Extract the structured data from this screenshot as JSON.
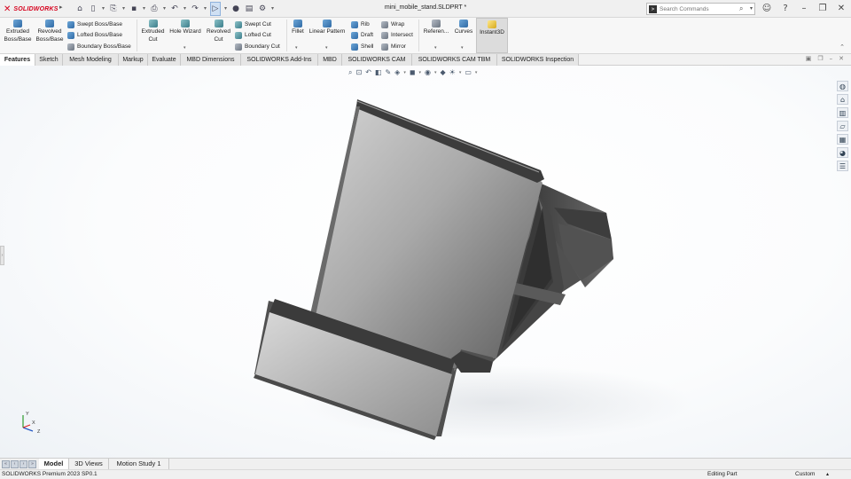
{
  "app": {
    "logo_text": "SOLIDWORKS",
    "window_title": "mini_mobile_stand.SLDPRT *"
  },
  "search": {
    "placeholder": "Search Commands"
  },
  "ribbon": {
    "big_buttons": [
      {
        "id": "extruded-boss",
        "label1": "Extruded",
        "label2": "Boss/Base"
      },
      {
        "id": "revolved-boss",
        "label1": "Revolved",
        "label2": "Boss/Base"
      },
      {
        "id": "extruded-cut",
        "label1": "Extruded",
        "label2": "Cut"
      },
      {
        "id": "hole-wizard",
        "label1": "Hole Wizard",
        "label2": ""
      },
      {
        "id": "revolved-cut",
        "label1": "Revolved",
        "label2": "Cut"
      },
      {
        "id": "fillet",
        "label1": "Fillet",
        "label2": ""
      },
      {
        "id": "linear-pattern",
        "label1": "Linear Pattern",
        "label2": ""
      },
      {
        "id": "reference",
        "label1": "Referen...",
        "label2": ""
      },
      {
        "id": "curves",
        "label1": "Curves",
        "label2": ""
      },
      {
        "id": "instant3d",
        "label1": "Instant3D",
        "label2": ""
      }
    ],
    "small_buttons": {
      "swept_boss": "Swept Boss/Base",
      "lofted_boss": "Lofted Boss/Base",
      "boundary_boss": "Boundary Boss/Base",
      "swept_cut": "Swept Cut",
      "lofted_cut": "Lofted Cut",
      "boundary_cut": "Boundary Cut",
      "rib": "Rib",
      "draft": "Draft",
      "shell": "Shell",
      "wrap": "Wrap",
      "intersect": "Intersect",
      "mirror": "Mirror"
    }
  },
  "tabs": [
    "Features",
    "Sketch",
    "Mesh Modeling",
    "Markup",
    "Evaluate",
    "MBD Dimensions",
    "SOLIDWORKS Add-Ins",
    "MBD",
    "SOLIDWORKS CAM",
    "SOLIDWORKS CAM TBM",
    "SOLIDWORKS Inspection"
  ],
  "active_tab": "Features",
  "triad": {
    "x": "X",
    "y": "Y",
    "z": "Z"
  },
  "bottom_tabs": [
    "Model",
    "3D Views",
    "Motion Study 1"
  ],
  "status": {
    "left": "SOLIDWORKS Premium 2023 SP0.1",
    "mode": "Editing Part",
    "units": "Custom"
  },
  "colors": {
    "brand": "#d6001c",
    "accent": "#2f6aa5",
    "part_body": "#6f6f6f"
  },
  "icons": {
    "title_toolbar": [
      "home-icon",
      "new-file-icon",
      "open-icon",
      "save-icon",
      "print-icon",
      "undo-icon",
      "redo-icon",
      "select-icon",
      "rebuild-icon",
      "file-properties-icon",
      "options-icon"
    ],
    "task_pane": [
      "solidworks-resources-icon",
      "design-library-icon",
      "file-explorer-icon",
      "view-palette-icon",
      "appearances-icon",
      "custom-properties-icon",
      "forum-icon"
    ]
  }
}
